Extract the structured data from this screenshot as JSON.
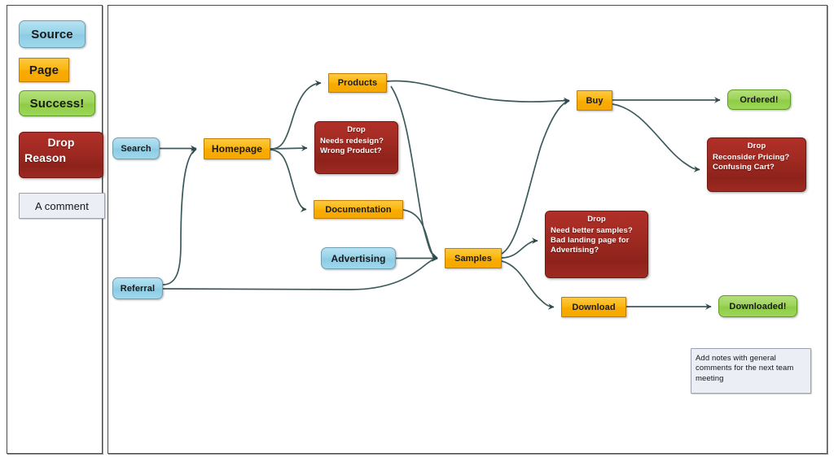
{
  "legend": {
    "items": [
      {
        "key": "source",
        "label": "Source",
        "style": "source",
        "color": "#9fd8ec"
      },
      {
        "key": "page",
        "label": "Page",
        "style": "page",
        "color": "#f8ab00"
      },
      {
        "key": "success",
        "label": "Success!",
        "style": "success",
        "color": "#9ed45c"
      },
      {
        "key": "drop",
        "title": "Drop",
        "label": "Reason",
        "style": "drop",
        "color": "#a02a22"
      },
      {
        "key": "comment",
        "label": "A comment",
        "style": "note",
        "color": "#eceef6"
      }
    ]
  },
  "diagram": {
    "edge_color": "#3d5a5c",
    "nodes": {
      "search": {
        "label": "Search",
        "type": "source"
      },
      "referral": {
        "label": "Referral",
        "type": "source"
      },
      "advertising": {
        "label": "Advertising",
        "type": "source"
      },
      "homepage": {
        "label": "Homepage",
        "type": "page"
      },
      "products": {
        "label": "Products",
        "type": "page"
      },
      "documentation": {
        "label": "Documentation",
        "type": "page"
      },
      "samples": {
        "label": "Samples",
        "type": "page"
      },
      "buy": {
        "label": "Buy",
        "type": "page"
      },
      "download": {
        "label": "Download",
        "type": "page"
      },
      "ordered": {
        "label": "Ordered!",
        "type": "success"
      },
      "downloaded": {
        "label": "Downloaded!",
        "type": "success"
      },
      "drop_homepage": {
        "type": "drop",
        "title": "Drop",
        "lines": [
          "Needs redesign?",
          "Wrong Product?"
        ]
      },
      "drop_buy": {
        "type": "drop",
        "title": "Drop",
        "lines": [
          "Reconsider Pricing?",
          "Confusing Cart?"
        ]
      },
      "drop_samples": {
        "type": "drop",
        "title": "Drop",
        "lines": [
          "Need better samples?",
          "Bad landing page for",
          "Advertising?"
        ]
      },
      "note": {
        "type": "note",
        "lines": [
          "Add notes with general",
          "comments for the next team",
          "meeting"
        ]
      }
    }
  }
}
